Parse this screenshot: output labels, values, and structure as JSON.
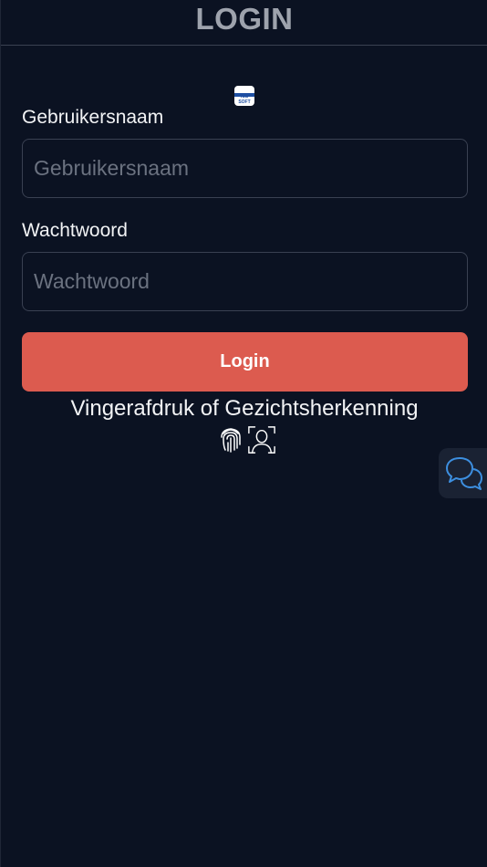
{
  "header": {
    "title": "LOGIN"
  },
  "logo": {
    "text": "ICS SOFT"
  },
  "username": {
    "label": "Gebruikersnaam",
    "placeholder": "Gebruikersnaam",
    "value": ""
  },
  "password": {
    "label": "Wachtwoord",
    "placeholder": "Wachtwoord",
    "value": ""
  },
  "login_button": {
    "label": "Login"
  },
  "biometric": {
    "text": "Vingerafdruk of Gezichtsherkenning",
    "icons": [
      "fingerprint-icon",
      "face-id-icon"
    ]
  },
  "chat": {
    "icon": "chat-bubbles-icon"
  },
  "colors": {
    "background": "#0b1222",
    "accent": "#dc5b4f",
    "chat_icon": "#3d8fe0"
  }
}
